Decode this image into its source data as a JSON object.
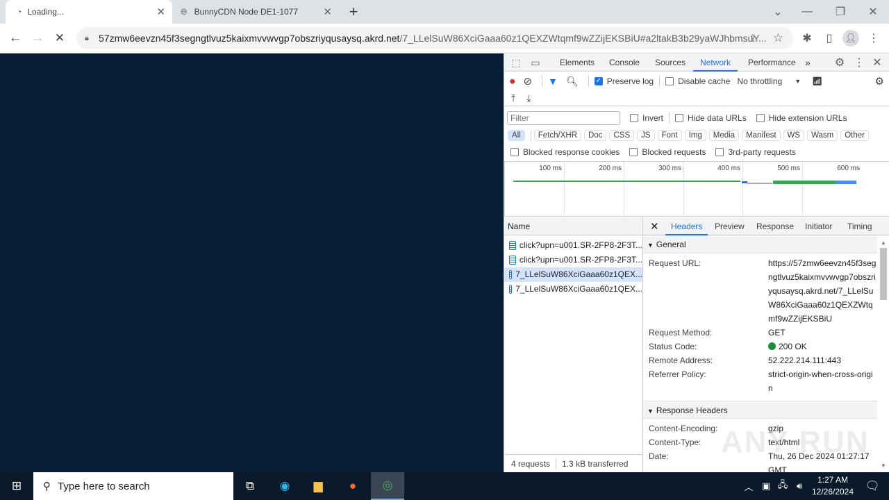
{
  "browser": {
    "tabs": [
      {
        "title": "Loading...",
        "active": true
      },
      {
        "title": "BunnyCDN Node DE1-1077",
        "active": false
      }
    ],
    "url_host": "57zmw6eevzn45f3segngtlvuz5kaixmvvwvgp7obszriyqusaysq.akrd.net",
    "url_rest": "/7_LLelSuW86XciGaaa60z1QEXZWtqmf9wZZijEKSBiU#a2ltakB3b29yaWJhbmsuY..."
  },
  "devtools": {
    "tabs": [
      "Elements",
      "Console",
      "Sources",
      "Network",
      "Performance"
    ],
    "active_tab": "Network",
    "preserve_log": {
      "label": "Preserve log",
      "checked": true
    },
    "disable_cache": {
      "label": "Disable cache",
      "checked": false
    },
    "throttling": "No throttling",
    "filter_placeholder": "Filter",
    "invert": "Invert",
    "hide_data_urls": "Hide data URLs",
    "hide_extension_urls": "Hide extension URLs",
    "type_filters": [
      "All",
      "Fetch/XHR",
      "Doc",
      "CSS",
      "JS",
      "Font",
      "Img",
      "Media",
      "Manifest",
      "WS",
      "Wasm",
      "Other"
    ],
    "active_type": "All",
    "blocked_response_cookies": "Blocked response cookies",
    "blocked_requests": "Blocked requests",
    "third_party": "3rd-party requests",
    "timeline_ticks": [
      "100 ms",
      "200 ms",
      "300 ms",
      "400 ms",
      "500 ms",
      "600 ms"
    ],
    "name_header": "Name",
    "requests": [
      {
        "name": "click?upn=u001.SR-2FP8-2F3T...",
        "selected": false
      },
      {
        "name": "click?upn=u001.SR-2FP8-2F3T...",
        "selected": false
      },
      {
        "name": "7_LLelSuW86XciGaaa60z1QEX...",
        "selected": true
      },
      {
        "name": "7_LLelSuW86XciGaaa60z1QEX...",
        "selected": false
      }
    ],
    "summary": {
      "requests": "4 requests",
      "transferred": "1.3 kB transferred"
    },
    "detail_tabs": [
      "Headers",
      "Preview",
      "Response",
      "Initiator",
      "Timing"
    ],
    "active_detail_tab": "Headers",
    "general": {
      "title": "General",
      "rows": [
        {
          "k": "Request URL:",
          "v": "https://57zmw6eevzn45f3segngtlvuz5kaixmvvwvgp7obszriyqusaysq.akrd.net/7_LLelSuW86XciGaaa60z1QEXZWtqmf9wZZijEKSBiU"
        },
        {
          "k": "Request Method:",
          "v": "GET"
        },
        {
          "k": "Status Code:",
          "v": "200 OK"
        },
        {
          "k": "Remote Address:",
          "v": "52.222.214.111:443"
        },
        {
          "k": "Referrer Policy:",
          "v": "strict-origin-when-cross-origin"
        }
      ]
    },
    "response_headers": {
      "title": "Response Headers",
      "rows": [
        {
          "k": "Content-Encoding:",
          "v": "gzip"
        },
        {
          "k": "Content-Type:",
          "v": "text/html"
        },
        {
          "k": "Date:",
          "v": "Thu, 26 Dec 2024 01:27:17 GMT"
        }
      ]
    },
    "status_color": "#1e8e3e"
  },
  "watermark": "ANY RUN",
  "taskbar": {
    "search_placeholder": "Type here to search",
    "time": "1:27 AM",
    "date": "12/26/2024"
  }
}
